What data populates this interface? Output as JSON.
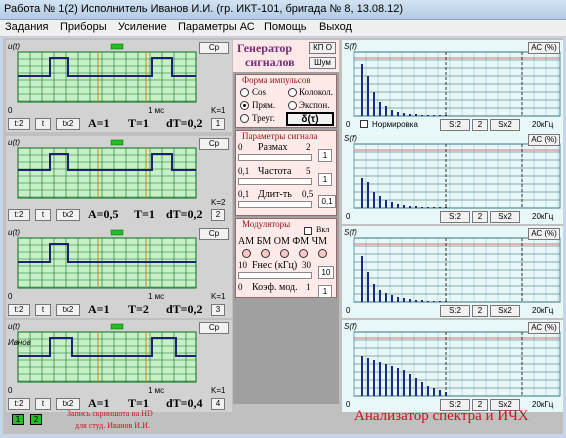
{
  "title": "Работа № 1(2)  Исполнитель Иванов  И.И. (гр. ИКТ-101, бригада № 8, 13.08.12)",
  "menu": [
    "Задания",
    "Приборы",
    "Усиление",
    "Параметры АС",
    "Помощь",
    "Выход"
  ],
  "osc": [
    {
      "ylabel": "u(t)",
      "cb": "Ср",
      "b1": "t:2",
      "b2": "t",
      "b3": "tx2",
      "A": "A=1",
      "T": "T=1",
      "dT": "dT=0,2",
      "k": "K=1",
      "kval": "1",
      "t0": "0",
      "t1": "1 мс"
    },
    {
      "ylabel": "u(t)",
      "cb": "Ср",
      "b1": "t:2",
      "b2": "t",
      "b3": "tx2",
      "A": "A=0,5",
      "T": "T=1",
      "dT": "dT=0,2",
      "k": "K=2",
      "kval": "2",
      "t0": "",
      "t1": ""
    },
    {
      "ylabel": "u(t)",
      "cb": "Ср",
      "b1": "t:2",
      "b2": "t",
      "b3": "tx2",
      "A": "A=1",
      "T": "T=2",
      "dT": "dT=0,2",
      "k": "K=1",
      "kval": "3",
      "t0": "0",
      "t1": "1 мс"
    },
    {
      "ylabel": "u(t)",
      "cb": "Ср",
      "b1": "t:2",
      "b2": "t",
      "b3": "tx2",
      "A": "A=1",
      "T": "T=1",
      "dT": "dT=0,4",
      "k": "K=1",
      "kval": "4",
      "t0": "0",
      "t1": "1 мс",
      "extra": "Ивнов"
    }
  ],
  "gen": {
    "title1": "Генератор",
    "title2": "сигналов",
    "kpo": "КП О",
    "noise": "Шум"
  },
  "form": {
    "label": "Форма импульсов",
    "cos": "Cos",
    "kolokol": "Колокол.",
    "pram": "Прям.",
    "expon": "Экспон.",
    "treug": "Треуг.",
    "delta": "δ(τ)"
  },
  "params": {
    "label": "Параметры сигнала",
    "razmah": "Размах",
    "r0": "0",
    "r2": "2",
    "rv": "1",
    "chastota": "Частота",
    "c0": "0,1",
    "c5": "5",
    "cv": "1",
    "dlit": "Длит-ть",
    "d0": "0,1",
    "d5": "0,5",
    "dv": "0,1"
  },
  "mod": {
    "label": "Модуляторы",
    "vkl": "Вкл",
    "types": "АМ БМ ОМ ФМ ЧМ",
    "fnes": "Fнес (кГц)",
    "f10": "10",
    "f30": "30",
    "fv": "10",
    "koef": "Коэф. мод.",
    "k0": "0",
    "k1": "1",
    "kv": "1"
  },
  "spec": [
    {
      "ylabel": "S(f)",
      "ac": "АС (%)",
      "norm": "Нормировка",
      "s2": "S:2",
      "s": "2",
      "sx2": "Sx2",
      "f": "20кГц",
      "z": "0"
    },
    {
      "ylabel": "S(f)",
      "ac": "АС (%)",
      "norm": "",
      "s2": "S:2",
      "s": "2",
      "sx2": "Sx2",
      "f": "20кГц",
      "z": "0"
    },
    {
      "ylabel": "S(f)",
      "ac": "АС (%)",
      "norm": "",
      "s2": "S:2",
      "s": "2",
      "sx2": "Sx2",
      "f": "20кГц",
      "z": "0"
    },
    {
      "ylabel": "S(f)",
      "ac": "АС (%)",
      "norm": "",
      "s2": "S:2",
      "s": "2",
      "sx2": "Sx2",
      "f": "20кГц",
      "z": "0"
    }
  ],
  "footer": {
    "note1": "Запись скриншота на HD",
    "note2": "для студ. Иванов И.И.",
    "b1": "1",
    "b2": "2",
    "big": "Анализатор спектра и ИЧХ"
  },
  "colors": {
    "grid": "#0a6e1e",
    "signal": "#202070",
    "spec": "#1a2a8a",
    "red": "#c8141e"
  }
}
